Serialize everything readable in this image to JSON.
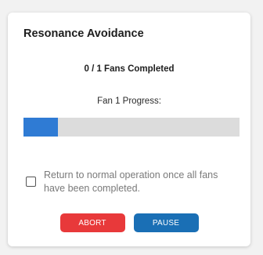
{
  "dialog": {
    "title": "Resonance Avoidance",
    "fans_completed": "0 / 1 Fans Completed",
    "fan_progress_label": "Fan 1 Progress:",
    "fan_progress_fraction": 0.16,
    "checkbox": {
      "label": "Return to normal operation once all fans have been completed.",
      "checked": false
    },
    "buttons": {
      "abort_label": "ABORT",
      "pause_label": "PAUSE"
    }
  },
  "colors": {
    "progress_fill": "#2f7bd4",
    "progress_track": "#dcdcdc",
    "abort": "#e8393a",
    "pause": "#1a6fb5"
  }
}
